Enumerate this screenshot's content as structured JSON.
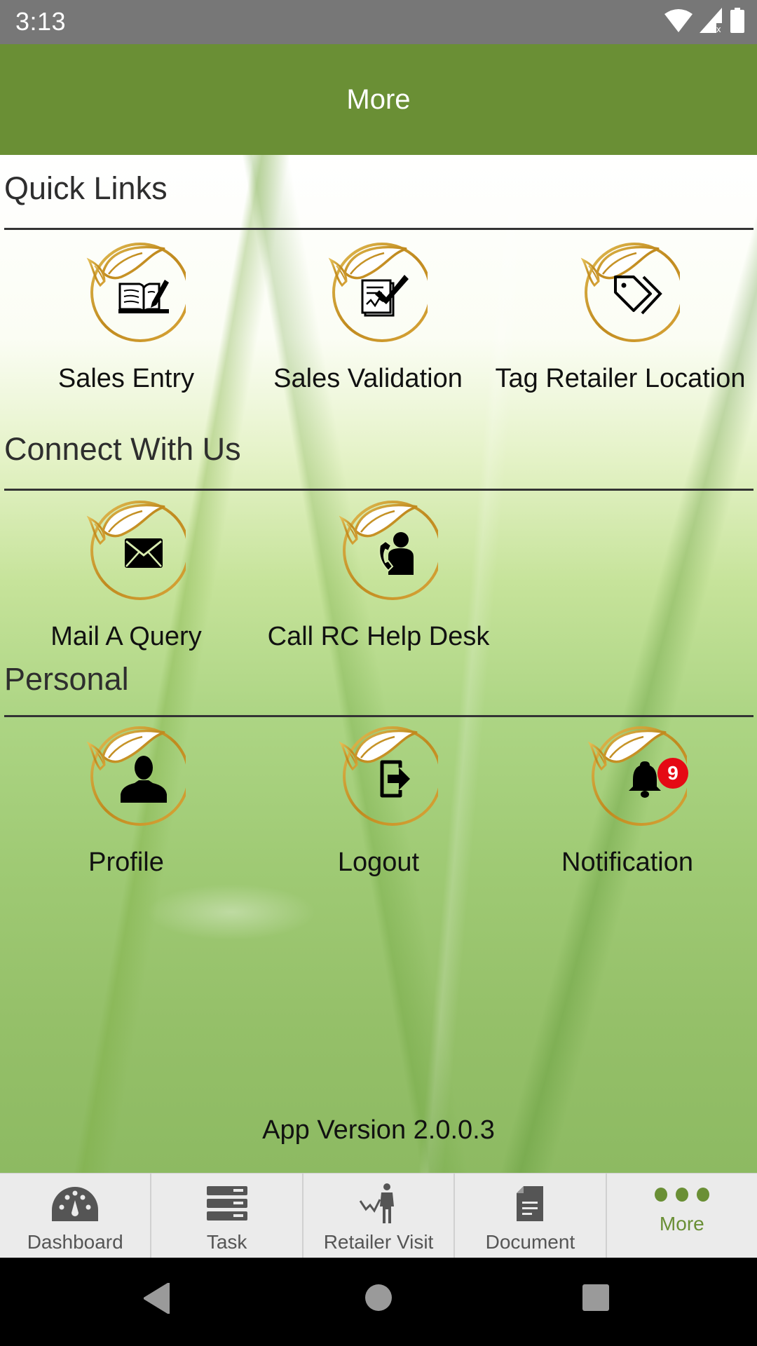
{
  "status_bar": {
    "time": "3:13",
    "icons": [
      "wifi-icon",
      "signal-no-data-icon",
      "battery-icon"
    ]
  },
  "app_bar": {
    "title": "More"
  },
  "sections": {
    "quick_links": {
      "title": "Quick Links",
      "items": [
        {
          "label": "Sales Entry",
          "icon": "book-edit-icon"
        },
        {
          "label": "Sales Validation",
          "icon": "document-check-icon"
        },
        {
          "label": "Tag Retailer Location",
          "icon": "tags-icon"
        }
      ]
    },
    "connect": {
      "title": "Connect With Us",
      "items": [
        {
          "label": "Mail A Query",
          "icon": "envelope-icon"
        },
        {
          "label": "Call RC Help Desk",
          "icon": "phone-user-icon"
        }
      ]
    },
    "personal": {
      "title": "Personal",
      "items": [
        {
          "label": "Profile",
          "icon": "user-icon"
        },
        {
          "label": "Logout",
          "icon": "logout-icon"
        },
        {
          "label": "Notification",
          "icon": "bell-icon",
          "badge": "9"
        }
      ]
    }
  },
  "app_version": "App Version 2.0.0.3",
  "bottom_nav": {
    "items": [
      {
        "label": "Dashboard",
        "icon": "gauge-icon",
        "active": false
      },
      {
        "label": "Task",
        "icon": "task-list-icon",
        "active": false
      },
      {
        "label": "Retailer Visit",
        "icon": "person-chart-icon",
        "active": false
      },
      {
        "label": "Document",
        "icon": "document-icon",
        "active": false
      },
      {
        "label": "More",
        "icon": "more-dots-icon",
        "active": true
      }
    ]
  },
  "colors": {
    "brand_green": "#6a8f35",
    "status_bar": "#777777",
    "gold_ring": "#c9a033",
    "badge_red": "#e50914"
  }
}
